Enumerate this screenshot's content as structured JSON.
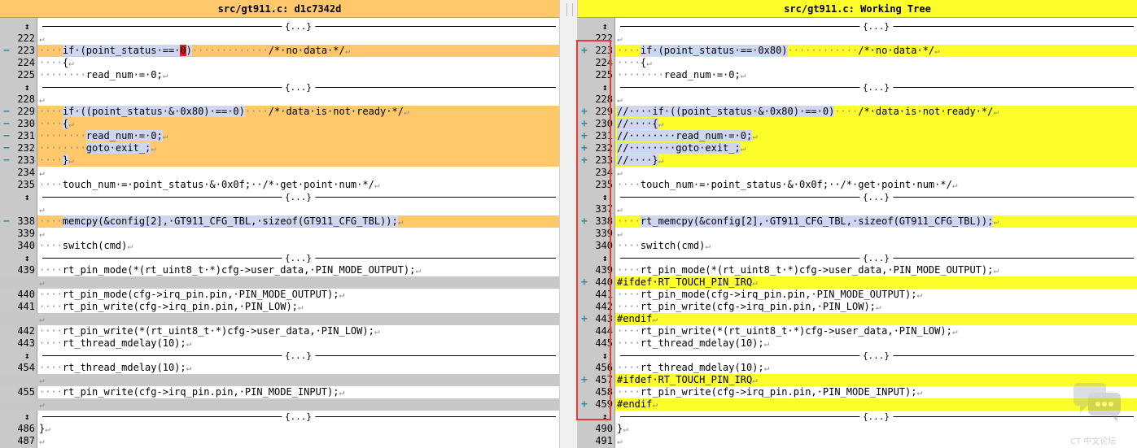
{
  "left": {
    "title": "src/gt911.c: d1c7342d",
    "rows": [
      {
        "kind": "fold",
        "label": "{...}"
      },
      {
        "kind": "line",
        "num": "222",
        "text": ""
      },
      {
        "kind": "line",
        "num": "223",
        "mark": "−",
        "bg": "mod",
        "segs": [
          [
            "ws",
            "····"
          ],
          [
            "hl-blue",
            "if·(point_status·==·"
          ],
          [
            "hl-del",
            "0"
          ],
          [
            "hl-blue",
            ")"
          ],
          [
            "ws",
            "·············"
          ],
          [
            "",
            "/*·no·data·*/"
          ]
        ]
      },
      {
        "kind": "line",
        "num": "224",
        "segs": [
          [
            "ws",
            "····"
          ],
          [
            "",
            "{"
          ]
        ]
      },
      {
        "kind": "line",
        "num": "225",
        "segs": [
          [
            "ws",
            "········"
          ],
          [
            "",
            "read_num·=·0;"
          ]
        ]
      },
      {
        "kind": "fold",
        "label": "{...}"
      },
      {
        "kind": "line",
        "num": "228",
        "text": ""
      },
      {
        "kind": "line",
        "num": "229",
        "mark": "−",
        "bg": "mod",
        "segs": [
          [
            "ws",
            "····"
          ],
          [
            "hl-blue",
            "if·((point_status·&·0x80)·==·0)"
          ],
          [
            "ws",
            "····"
          ],
          [
            "",
            "/*·data·is·not·ready·*/"
          ]
        ]
      },
      {
        "kind": "line",
        "num": "230",
        "mark": "−",
        "bg": "mod",
        "segs": [
          [
            "ws",
            "····"
          ],
          [
            "hl-blue",
            "{"
          ]
        ]
      },
      {
        "kind": "line",
        "num": "231",
        "mark": "−",
        "bg": "mod",
        "segs": [
          [
            "ws",
            "········"
          ],
          [
            "hl-blue",
            "read_num·=·0;"
          ]
        ]
      },
      {
        "kind": "line",
        "num": "232",
        "mark": "−",
        "bg": "mod",
        "segs": [
          [
            "ws",
            "········"
          ],
          [
            "hl-blue",
            "goto·exit_;"
          ]
        ]
      },
      {
        "kind": "line",
        "num": "233",
        "mark": "−",
        "bg": "mod",
        "segs": [
          [
            "ws",
            "····"
          ],
          [
            "hl-blue",
            "}"
          ]
        ]
      },
      {
        "kind": "line",
        "num": "234",
        "text": ""
      },
      {
        "kind": "line",
        "num": "235",
        "segs": [
          [
            "ws",
            "····"
          ],
          [
            "",
            "touch_num·=·point_status·&·0x0f;··/*·get·point·num·*/"
          ]
        ]
      },
      {
        "kind": "fold",
        "label": "{...}"
      },
      {
        "kind": "line",
        "num": "",
        "text": ""
      },
      {
        "kind": "line",
        "num": "338",
        "mark": "−",
        "bg": "mod",
        "segs": [
          [
            "ws",
            "····"
          ],
          [
            "hl-blue",
            "memcpy(&config[2],·GT911_CFG_TBL,·sizeof(GT911_CFG_TBL));"
          ]
        ]
      },
      {
        "kind": "line",
        "num": "339",
        "text": ""
      },
      {
        "kind": "line",
        "num": "340",
        "segs": [
          [
            "ws",
            "····"
          ],
          [
            "",
            "switch(cmd)"
          ]
        ]
      },
      {
        "kind": "fold",
        "label": "{...}"
      },
      {
        "kind": "line",
        "num": "439",
        "segs": [
          [
            "ws",
            "····"
          ],
          [
            "",
            "rt_pin_mode(*(rt_uint8_t·*)cfg->user_data,·PIN_MODE_OUTPUT);"
          ]
        ]
      },
      {
        "kind": "line",
        "num": "",
        "bg": "gray",
        "text": ""
      },
      {
        "kind": "line",
        "num": "440",
        "segs": [
          [
            "ws",
            "····"
          ],
          [
            "",
            "rt_pin_mode(cfg->irq_pin.pin,·PIN_MODE_OUTPUT);"
          ]
        ]
      },
      {
        "kind": "line",
        "num": "441",
        "segs": [
          [
            "ws",
            "····"
          ],
          [
            "",
            "rt_pin_write(cfg->irq_pin.pin,·PIN_LOW);"
          ]
        ]
      },
      {
        "kind": "line",
        "num": "",
        "bg": "gray",
        "text": ""
      },
      {
        "kind": "line",
        "num": "442",
        "segs": [
          [
            "ws",
            "····"
          ],
          [
            "",
            "rt_pin_write(*(rt_uint8_t·*)cfg->user_data,·PIN_LOW);"
          ]
        ]
      },
      {
        "kind": "line",
        "num": "443",
        "segs": [
          [
            "ws",
            "····"
          ],
          [
            "",
            "rt_thread_mdelay(10);"
          ]
        ]
      },
      {
        "kind": "fold",
        "label": "{...}"
      },
      {
        "kind": "line",
        "num": "454",
        "segs": [
          [
            "ws",
            "····"
          ],
          [
            "",
            "rt_thread_mdelay(10);"
          ]
        ]
      },
      {
        "kind": "line",
        "num": "",
        "bg": "gray",
        "text": ""
      },
      {
        "kind": "line",
        "num": "455",
        "segs": [
          [
            "ws",
            "····"
          ],
          [
            "",
            "rt_pin_write(cfg->irq_pin.pin,·PIN_MODE_INPUT);"
          ]
        ]
      },
      {
        "kind": "line",
        "num": "",
        "bg": "gray",
        "text": ""
      },
      {
        "kind": "fold",
        "label": "{...}"
      },
      {
        "kind": "line",
        "num": "486",
        "segs": [
          [
            "",
            "}"
          ]
        ]
      },
      {
        "kind": "line",
        "num": "487",
        "text": ""
      }
    ]
  },
  "right": {
    "title": "src/gt911.c: Working Tree",
    "rows": [
      {
        "kind": "fold",
        "label": "{...}"
      },
      {
        "kind": "line",
        "num": "222",
        "text": ""
      },
      {
        "kind": "line",
        "num": "223",
        "mark": "+",
        "bg": "add",
        "segs": [
          [
            "ws",
            "····"
          ],
          [
            "hl-blue",
            "if·(point_status·==·0x80)"
          ],
          [
            "ws",
            "············"
          ],
          [
            "",
            "/*·no·data·*/"
          ]
        ]
      },
      {
        "kind": "line",
        "num": "224",
        "segs": [
          [
            "ws",
            "····"
          ],
          [
            "",
            "{"
          ]
        ]
      },
      {
        "kind": "line",
        "num": "225",
        "segs": [
          [
            "ws",
            "········"
          ],
          [
            "",
            "read_num·=·0;"
          ]
        ]
      },
      {
        "kind": "fold",
        "label": "{...}"
      },
      {
        "kind": "line",
        "num": "228",
        "text": ""
      },
      {
        "kind": "line",
        "num": "229",
        "mark": "+",
        "bg": "add",
        "segs": [
          [
            "hl-blue",
            "//····if·((point_status·&·0x80)·==·0)"
          ],
          [
            "ws",
            "····"
          ],
          [
            "",
            "/*·data·is·not·ready·*/"
          ]
        ]
      },
      {
        "kind": "line",
        "num": "230",
        "mark": "+",
        "bg": "add",
        "segs": [
          [
            "hl-blue",
            "//····{"
          ]
        ]
      },
      {
        "kind": "line",
        "num": "231",
        "mark": "+",
        "bg": "add",
        "segs": [
          [
            "hl-blue",
            "//········read_num·=·0;"
          ]
        ]
      },
      {
        "kind": "line",
        "num": "232",
        "mark": "+",
        "bg": "add",
        "segs": [
          [
            "hl-blue",
            "//········goto·exit_;"
          ]
        ]
      },
      {
        "kind": "line",
        "num": "233",
        "mark": "+",
        "bg": "add",
        "segs": [
          [
            "hl-blue",
            "//····}"
          ]
        ]
      },
      {
        "kind": "line",
        "num": "234",
        "text": ""
      },
      {
        "kind": "line",
        "num": "235",
        "segs": [
          [
            "ws",
            "····"
          ],
          [
            "",
            "touch_num·=·point_status·&·0x0f;··/*·get·point·num·*/"
          ]
        ]
      },
      {
        "kind": "fold",
        "label": "{...}"
      },
      {
        "kind": "line",
        "num": "337",
        "text": ""
      },
      {
        "kind": "line",
        "num": "338",
        "mark": "+",
        "bg": "add",
        "segs": [
          [
            "ws",
            "····"
          ],
          [
            "hl-blue",
            "rt_memcpy(&config[2],·GT911_CFG_TBL,·sizeof(GT911_CFG_TBL));"
          ]
        ]
      },
      {
        "kind": "line",
        "num": "339",
        "text": ""
      },
      {
        "kind": "line",
        "num": "340",
        "segs": [
          [
            "ws",
            "····"
          ],
          [
            "",
            "switch(cmd)"
          ]
        ]
      },
      {
        "kind": "fold",
        "label": "{...}"
      },
      {
        "kind": "line",
        "num": "439",
        "segs": [
          [
            "ws",
            "····"
          ],
          [
            "",
            "rt_pin_mode(*(rt_uint8_t·*)cfg->user_data,·PIN_MODE_OUTPUT);"
          ]
        ]
      },
      {
        "kind": "line",
        "num": "440",
        "mark": "+",
        "bg": "add",
        "segs": [
          [
            "",
            "#ifdef·RT_TOUCH_PIN_IRQ"
          ]
        ]
      },
      {
        "kind": "line",
        "num": "441",
        "segs": [
          [
            "ws",
            "····"
          ],
          [
            "",
            "rt_pin_mode(cfg->irq_pin.pin,·PIN_MODE_OUTPUT);"
          ]
        ]
      },
      {
        "kind": "line",
        "num": "442",
        "segs": [
          [
            "ws",
            "····"
          ],
          [
            "",
            "rt_pin_write(cfg->irq_pin.pin,·PIN_LOW);"
          ]
        ]
      },
      {
        "kind": "line",
        "num": "443",
        "mark": "+",
        "bg": "add",
        "segs": [
          [
            "",
            "#endif"
          ]
        ]
      },
      {
        "kind": "line",
        "num": "444",
        "segs": [
          [
            "ws",
            "····"
          ],
          [
            "",
            "rt_pin_write(*(rt_uint8_t·*)cfg->user_data,·PIN_LOW);"
          ]
        ]
      },
      {
        "kind": "line",
        "num": "445",
        "segs": [
          [
            "ws",
            "····"
          ],
          [
            "",
            "rt_thread_mdelay(10);"
          ]
        ]
      },
      {
        "kind": "fold",
        "label": "{...}"
      },
      {
        "kind": "line",
        "num": "456",
        "segs": [
          [
            "ws",
            "····"
          ],
          [
            "",
            "rt_thread_mdelay(10);"
          ]
        ]
      },
      {
        "kind": "line",
        "num": "457",
        "mark": "+",
        "bg": "add",
        "segs": [
          [
            "",
            "#ifdef·RT_TOUCH_PIN_IRQ"
          ]
        ]
      },
      {
        "kind": "line",
        "num": "458",
        "segs": [
          [
            "ws",
            "····"
          ],
          [
            "",
            "rt_pin_write(cfg->irq_pin.pin,·PIN_MODE_INPUT);"
          ]
        ]
      },
      {
        "kind": "line",
        "num": "459",
        "mark": "+",
        "bg": "add",
        "segs": [
          [
            "",
            "#endif"
          ]
        ]
      },
      {
        "kind": "fold",
        "label": "{...}"
      },
      {
        "kind": "line",
        "num": "490",
        "segs": [
          [
            "",
            "}"
          ]
        ]
      },
      {
        "kind": "line",
        "num": "491",
        "text": ""
      }
    ]
  },
  "colors": {
    "old_header": "#ffc96b",
    "new_header": "#fdfd2a",
    "changed_old": "#ffc96b",
    "changed_new": "#fdfd2a",
    "deleted_char": "#e52020",
    "inline_blue": "#cfd6f0",
    "highlight_box": "#e53935"
  },
  "icons": {
    "fold": "fold-arrows-icon",
    "minus": "minus-marker-icon",
    "plus": "plus-marker-icon",
    "watermark": "chat-bubble-icon"
  },
  "watermark_text": "CT 中文论坛",
  "pilcrow": "↵"
}
